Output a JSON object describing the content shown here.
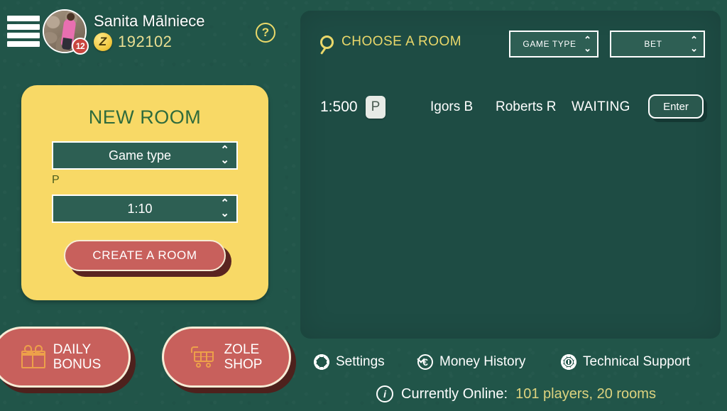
{
  "topbar": {
    "menu_icon": "hamburger-icon",
    "avatar_icon": "user-avatar",
    "level_badge": "12",
    "user_name": "Sanita Mālniece",
    "coin_icon": "zole-coin-icon",
    "balance": "192102",
    "help_icon": "question-mark-icon"
  },
  "new_room": {
    "title": "NEW ROOM",
    "game_type_value": "Game type",
    "game_type_note": "P",
    "bet_value": "1:10",
    "create_label": "CREATE A ROOM",
    "spinner_up": "⌃",
    "spinner_down": "⌄"
  },
  "promos": [
    {
      "name": "daily-bonus",
      "icon": "gift-icon",
      "label": "DAILY\nBONUS"
    },
    {
      "name": "zole-shop",
      "icon": "shopping-cart-icon",
      "label": "ZOLE\nSHOP"
    }
  ],
  "room_panel": {
    "search_icon": "magnifier-icon",
    "heading": "CHOOSE A ROOM",
    "filters": [
      {
        "name": "filter-gametype",
        "label": "GAME TYPE"
      },
      {
        "name": "filter-bet",
        "label": "BET"
      }
    ],
    "columns": [
      "bet",
      "type",
      "player1",
      "player2",
      "status",
      "action"
    ],
    "rooms": [
      {
        "bet": "1:500",
        "type": "P",
        "player1": "Igors B",
        "player2": "Roberts R",
        "status": "WAITING",
        "action": "Enter"
      }
    ]
  },
  "bottom_nav": [
    {
      "name": "nav-settings",
      "icon": "gear-icon",
      "label": "Settings"
    },
    {
      "name": "nav-money-history",
      "icon": "euro-refresh-icon",
      "label": "Money History"
    },
    {
      "name": "nav-technical-support",
      "icon": "support-gear-icon",
      "label": "Technical Support"
    }
  ],
  "online_status": {
    "icon": "info-icon",
    "label": "Currently Online:",
    "value": "101 players, 20 rooms"
  },
  "colors": {
    "background": "#215549",
    "panel": "#1e4c44",
    "card_yellow": "#f8d966",
    "accent_red": "#c8605c",
    "accent_gold": "#ead86a",
    "icon_orange": "#eda04a",
    "select_green": "#2d5f53"
  }
}
